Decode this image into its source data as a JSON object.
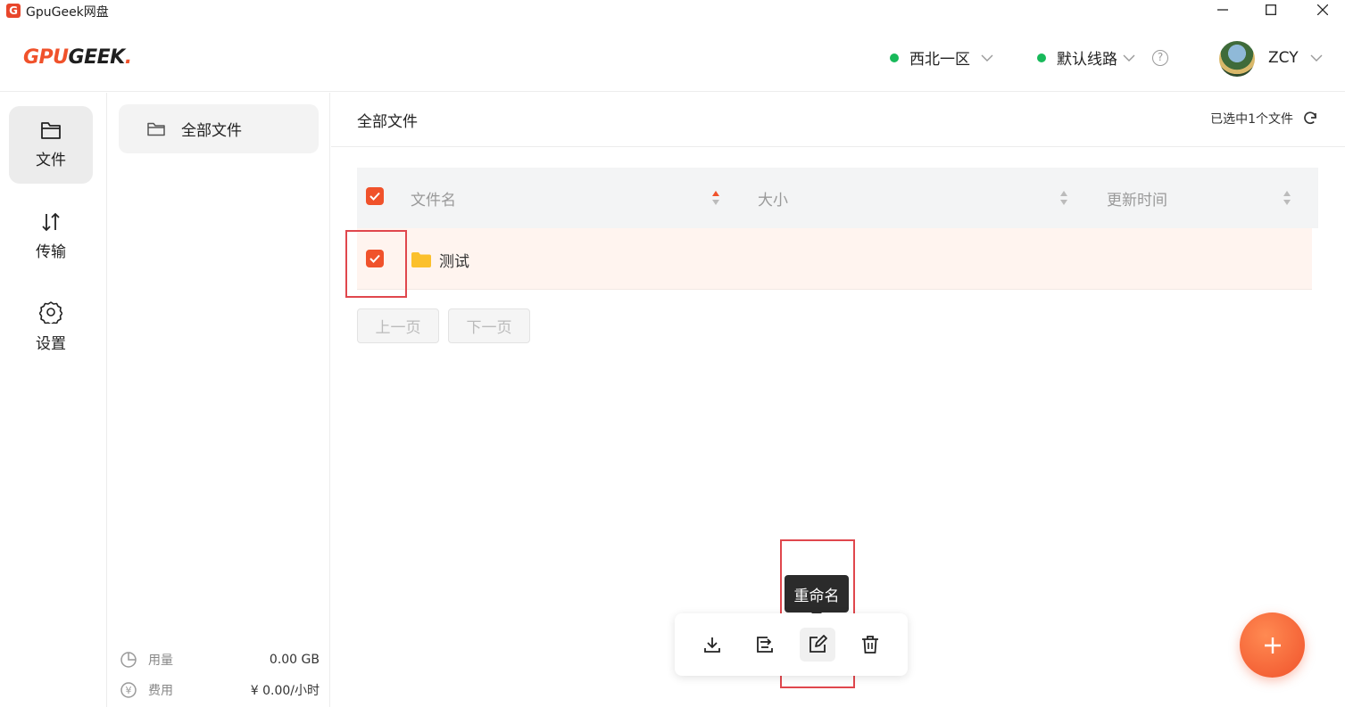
{
  "window": {
    "title": "GpuGeek网盘",
    "icon_letter": "G"
  },
  "header": {
    "logo_part1": "GPU",
    "logo_part2": "GEEK",
    "logo_dot": ".",
    "region": "西北一区",
    "line": "默认线路",
    "help": "?",
    "user": "ZCY"
  },
  "nav": [
    {
      "label": "文件",
      "icon": "folder-icon",
      "active": true
    },
    {
      "label": "传输",
      "icon": "transfer-icon"
    },
    {
      "label": "设置",
      "icon": "gear-icon"
    }
  ],
  "folders": {
    "all_files": "全部文件"
  },
  "stats": {
    "usage_label": "用量",
    "usage_value": "0.00 GB",
    "cost_label": "费用",
    "cost_value": "¥ 0.00/小时"
  },
  "main": {
    "breadcrumb": "全部文件",
    "selection_info": "已选中1个文件",
    "columns": [
      "文件名",
      "大小",
      "更新时间"
    ],
    "rows": [
      {
        "name": "测试",
        "size": "",
        "updated": "",
        "checked": true
      }
    ],
    "prev_page": "上一页",
    "next_page": "下一页"
  },
  "toolbar": {
    "tooltip": "重命名",
    "actions": [
      "download-icon",
      "move-icon",
      "rename-icon",
      "trash-icon"
    ]
  },
  "fab_label": "+",
  "colors": {
    "accent": "#f0522b",
    "green": "#18b95a",
    "row_selected": "#fff4ef",
    "highlight_box": "#e0474d"
  }
}
